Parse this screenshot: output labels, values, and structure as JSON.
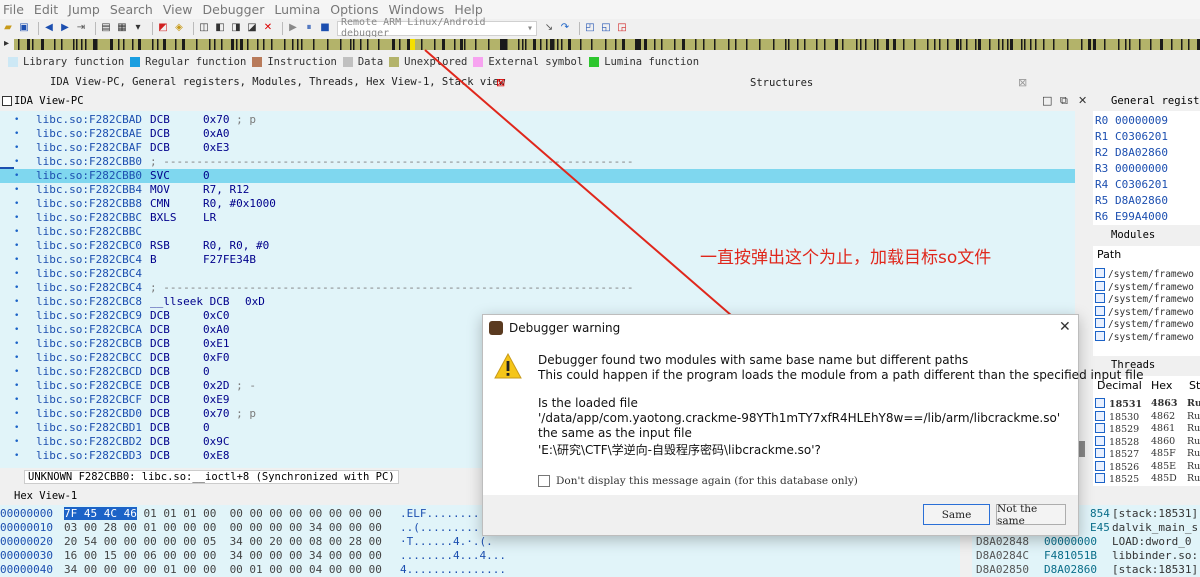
{
  "menu": [
    "File",
    "Edit",
    "Jump",
    "Search",
    "View",
    "Debugger",
    "Lumina",
    "Options",
    "Windows",
    "Help"
  ],
  "toolbar": {
    "debugger_select": "Remote ARM Linux/Android debugger"
  },
  "legend": [
    {
      "label": "Library function",
      "color": "#cde8f5"
    },
    {
      "label": "Regular function",
      "color": "#1a9ee0"
    },
    {
      "label": "Instruction",
      "color": "#b87a5a"
    },
    {
      "label": "Data",
      "color": "#c0c0c0"
    },
    {
      "label": "Unexplored",
      "color": "#b3b36a"
    },
    {
      "label": "External symbol",
      "color": "#f7a3f0"
    },
    {
      "label": "Lumina function",
      "color": "#2ec62e"
    }
  ],
  "tabs": {
    "left": "IDA View-PC, General registers, Modules, Threads, Hex View-1, Stack view",
    "structures": "Structures"
  },
  "ida_view": {
    "title": "IDA View-PC",
    "pc_label": "PC",
    "lines": [
      {
        "addr": "libc.so:F282CBAD",
        "instr": "DCB",
        "ops": "0x70",
        "comment": "; p"
      },
      {
        "addr": "libc.so:F282CBAE",
        "instr": "DCB",
        "ops": "0xA0",
        "comment": ""
      },
      {
        "addr": "libc.so:F282CBAF",
        "instr": "DCB",
        "ops": "0xE3",
        "comment": ""
      },
      {
        "addr": "libc.so:F282CBB0",
        "instr": "",
        "ops": "",
        "comment": "; -----------------------------------------------------------------------"
      },
      {
        "addr": "libc.so:F282CBB0",
        "instr": "SVC",
        "ops": "0",
        "comment": "",
        "highlight": true
      },
      {
        "addr": "libc.so:F282CBB4",
        "instr": "MOV",
        "ops": "R7, R12",
        "comment": ""
      },
      {
        "addr": "libc.so:F282CBB8",
        "instr": "CMN",
        "ops": "R0, #0x1000",
        "comment": ""
      },
      {
        "addr": "libc.so:F282CBBC",
        "instr": "BXLS",
        "ops": "LR",
        "comment": ""
      },
      {
        "addr": "libc.so:F282CBBC",
        "instr": "",
        "ops": "",
        "comment": ""
      },
      {
        "addr": "libc.so:F282CBC0",
        "instr": "RSB",
        "ops": "R0, R0, #0",
        "comment": ""
      },
      {
        "addr": "libc.so:F282CBC4",
        "instr": "B",
        "ops": "F27FE34B",
        "comment": ""
      },
      {
        "addr": "libc.so:F282CBC4",
        "instr": "",
        "ops": "",
        "comment": ""
      },
      {
        "addr": "libc.so:F282CBC4",
        "instr": "",
        "ops": "",
        "comment": "; -----------------------------------------------------------------------"
      },
      {
        "addr": "libc.so:F282CBC8",
        "instr": "__llseek DCB",
        "ops": "0xD",
        "comment": ""
      },
      {
        "addr": "libc.so:F282CBC9",
        "instr": "DCB",
        "ops": "0xC0",
        "comment": ""
      },
      {
        "addr": "libc.so:F282CBCA",
        "instr": "DCB",
        "ops": "0xA0",
        "comment": ""
      },
      {
        "addr": "libc.so:F282CBCB",
        "instr": "DCB",
        "ops": "0xE1",
        "comment": ""
      },
      {
        "addr": "libc.so:F282CBCC",
        "instr": "DCB",
        "ops": "0xF0",
        "comment": ""
      },
      {
        "addr": "libc.so:F282CBCD",
        "instr": "DCB",
        "ops": "0",
        "comment": ""
      },
      {
        "addr": "libc.so:F282CBCE",
        "instr": "DCB",
        "ops": "0x2D",
        "comment": "; -"
      },
      {
        "addr": "libc.so:F282CBCF",
        "instr": "DCB",
        "ops": "0xE9",
        "comment": ""
      },
      {
        "addr": "libc.so:F282CBD0",
        "instr": "DCB",
        "ops": "0x70",
        "comment": "; p"
      },
      {
        "addr": "libc.so:F282CBD1",
        "instr": "DCB",
        "ops": "0",
        "comment": ""
      },
      {
        "addr": "libc.so:F282CBD2",
        "instr": "DCB",
        "ops": "0x9C",
        "comment": ""
      },
      {
        "addr": "libc.so:F282CBD3",
        "instr": "DCB",
        "ops": "0xE8",
        "comment": ""
      }
    ],
    "status": "UNKNOWN F282CBB0: libc.so:__ioctl+8 (Synchronized with PC)"
  },
  "hex_view": {
    "title": "Hex View-1",
    "rows": [
      {
        "addr": "00000000",
        "sel": "7F 45 4C 46",
        "bytes": " 01 01 01 00  00 00 00 00 00 00 00 00",
        "ascii": ".ELF........"
      },
      {
        "addr": "00000010",
        "sel": "",
        "bytes": "03 00 28 00 01 00 00 00  00 00 00 00 34 00 00 00",
        "ascii": "..(........."
      },
      {
        "addr": "00000020",
        "sel": "",
        "bytes": "20 54 00 00 00 00 00 05  34 00 20 00 08 00 28 00",
        "ascii": "·T......4.·.(."
      },
      {
        "addr": "00000030",
        "sel": "",
        "bytes": "16 00 15 00 06 00 00 00  34 00 00 00 34 00 00 00",
        "ascii": "........4...4..."
      },
      {
        "addr": "00000040",
        "sel": "",
        "bytes": "34 00 00 00 00 01 00 00  00 01 00 00 04 00 00 00",
        "ascii": "4..............."
      }
    ]
  },
  "stack_view": {
    "rows": [
      {
        "addr": "",
        "val": "854",
        "note": "[stack:18531]"
      },
      {
        "addr": "",
        "val": "E45",
        "note": "dalvik_main_s"
      },
      {
        "addr": "D8A02848",
        "val": "00000000",
        "note": "LOAD:dword_0"
      },
      {
        "addr": "D8A0284C",
        "val": "F481051B",
        "note": "libbinder.so:"
      },
      {
        "addr": "D8A02850",
        "val": "D8A02860",
        "note": "[stack:18531]"
      }
    ]
  },
  "registers": {
    "title": "General registers",
    "rows": [
      {
        "name": "R0",
        "value": "00000009"
      },
      {
        "name": "R1",
        "value": "C0306201"
      },
      {
        "name": "R2",
        "value": "D8A02860"
      },
      {
        "name": "R3",
        "value": "00000000"
      },
      {
        "name": "R4",
        "value": "C0306201"
      },
      {
        "name": "R5",
        "value": "D8A02860"
      },
      {
        "name": "R6",
        "value": "E99A4000"
      }
    ]
  },
  "modules": {
    "title": "Modules",
    "header": "Path",
    "rows": [
      "/system/framewo",
      "/system/framewo",
      "/system/framewo",
      "/system/framewo",
      "/system/framewo",
      "/system/framewo"
    ]
  },
  "threads": {
    "title": "Threads",
    "headers": [
      "Decimal",
      "Hex",
      "St"
    ],
    "rows": [
      {
        "dec": "18531",
        "hex": "4863",
        "st": "Ru",
        "bold": true
      },
      {
        "dec": "18530",
        "hex": "4862",
        "st": "Ru"
      },
      {
        "dec": "18529",
        "hex": "4861",
        "st": "Ru"
      },
      {
        "dec": "18528",
        "hex": "4860",
        "st": "Ru"
      },
      {
        "dec": "18527",
        "hex": "485F",
        "st": "Ru"
      },
      {
        "dec": "18526",
        "hex": "485E",
        "st": "Ru"
      },
      {
        "dec": "18525",
        "hex": "485D",
        "st": "Ru"
      }
    ]
  },
  "annotation": "一直按弹出这个为止，加载目标so文件",
  "dialog": {
    "title": "Debugger warning",
    "line1": "Debugger found two modules with same base name but different paths",
    "line2": "This could happen if the program loads the module from a path different than the specified input file",
    "line3": "Is the loaded file",
    "line4": "'/data/app/com.yaotong.crackme-98YTh1mTY7xfR4HLEhY8w==/lib/arm/libcrackme.so'",
    "line5": "the same as the input file",
    "line6": "'E:\\研究\\CTF\\学逆向-自毁程序密码\\libcrackme.so'?",
    "checkbox_label": "Don't display this message again (for this database only)",
    "btn_same": "Same",
    "btn_not_same": "Not the same"
  }
}
